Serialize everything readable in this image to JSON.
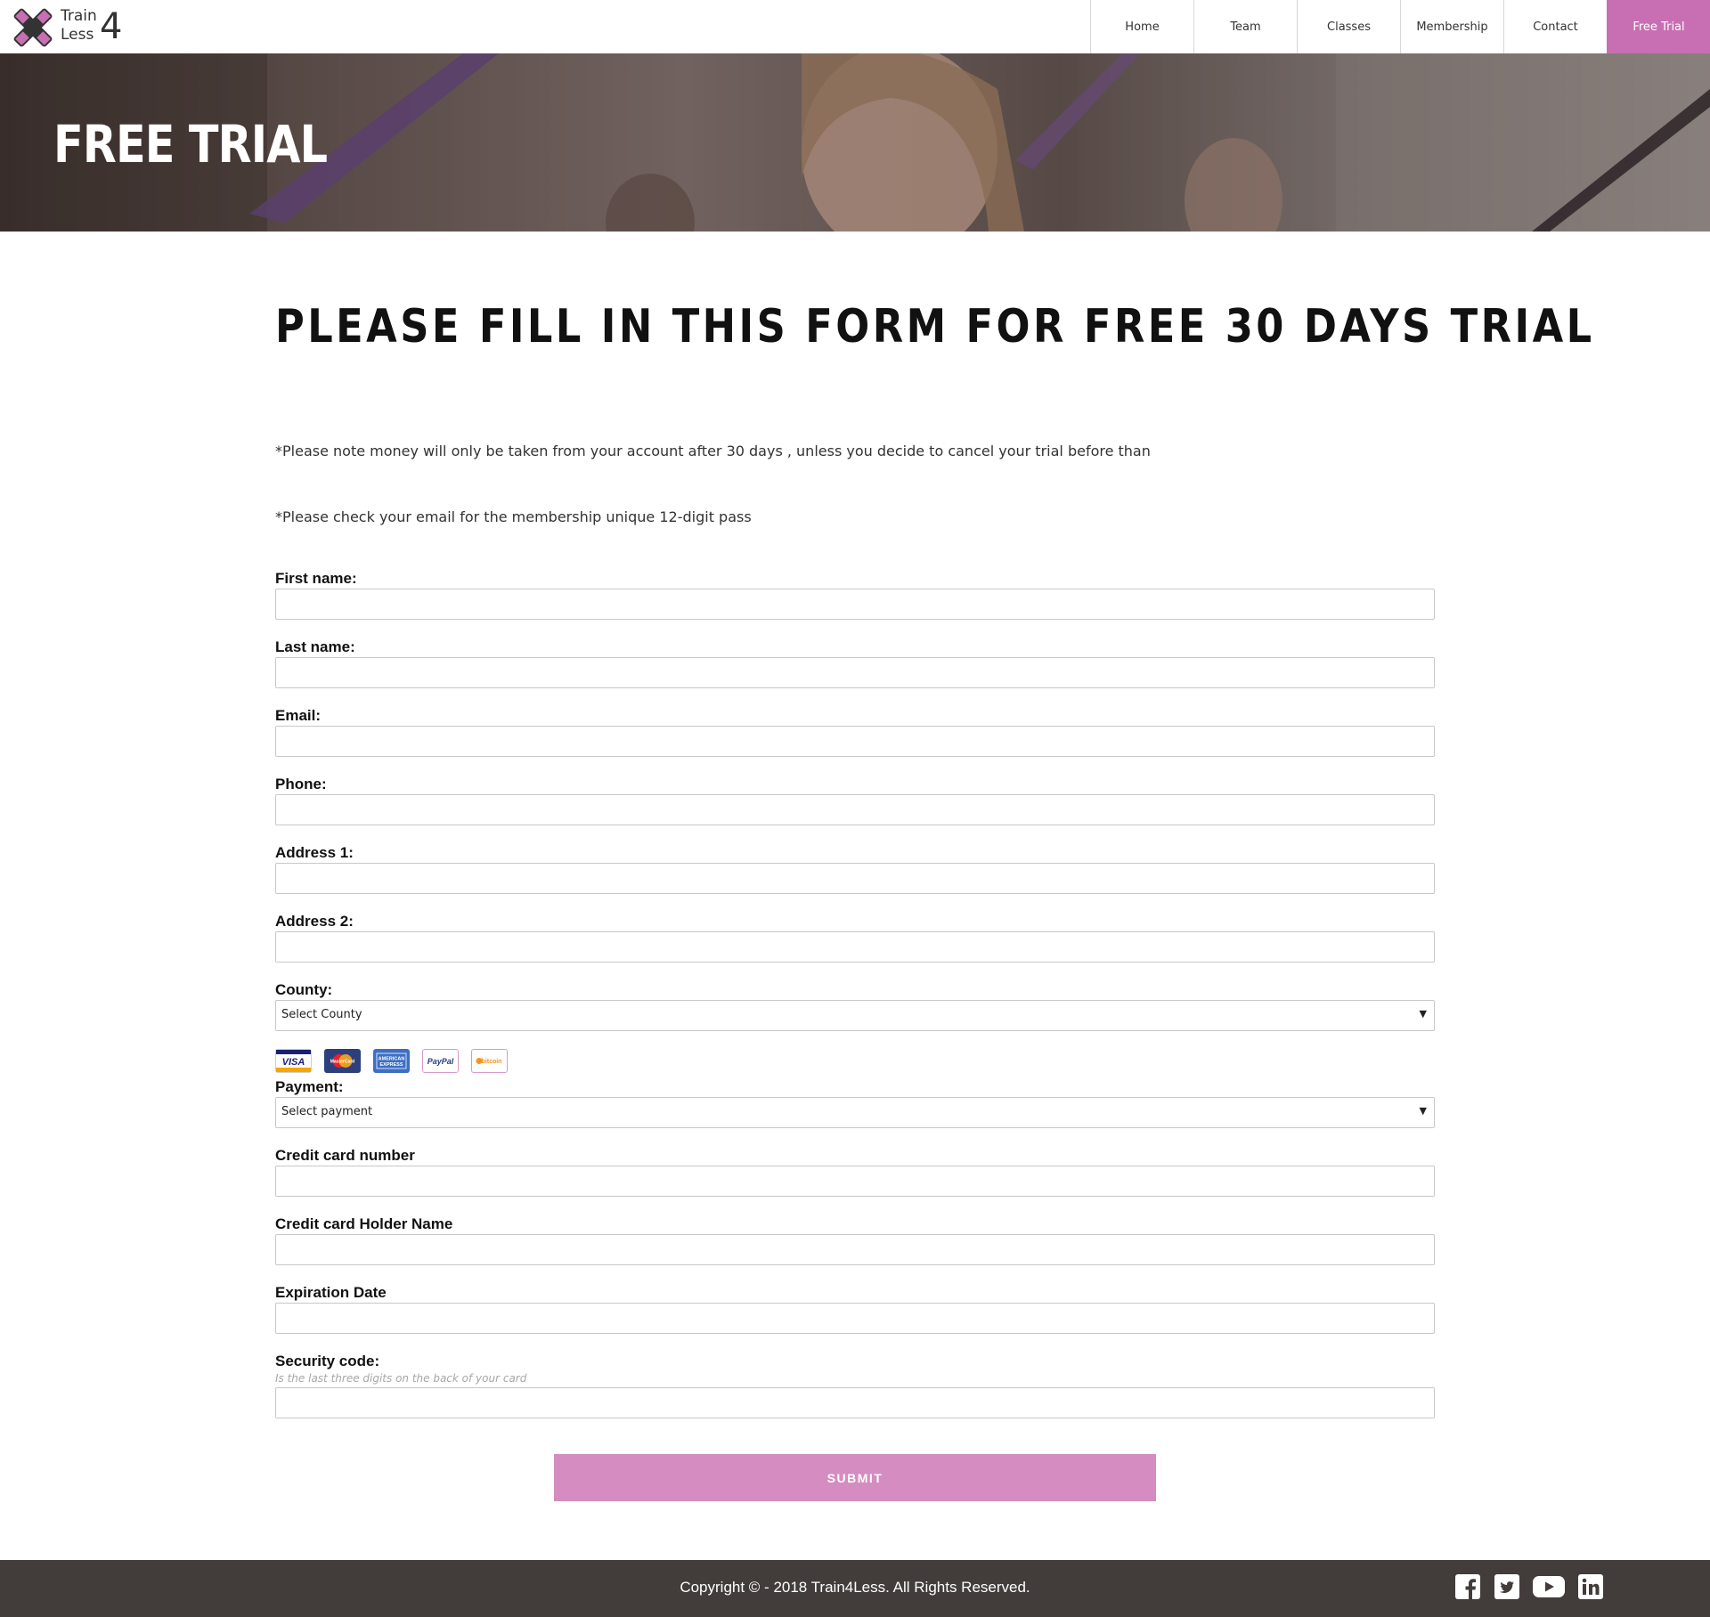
{
  "header": {
    "logo": {
      "word1": "Train",
      "word2": "Less",
      "number": "4"
    },
    "nav": [
      {
        "label": "Home",
        "active": false
      },
      {
        "label": "Team",
        "active": false
      },
      {
        "label": "Classes",
        "active": false
      },
      {
        "label": "Membership",
        "active": false
      },
      {
        "label": "Contact",
        "active": false
      },
      {
        "label": "Free Trial",
        "active": true
      }
    ]
  },
  "hero": {
    "title": "FREE TRIAL"
  },
  "main": {
    "heading": "PLEASE FILL IN THIS FORM FOR FREE 30 DAYS TRIAL",
    "note1": "*Please note money will only be taken from your account after 30 days , unless you decide to cancel your trial before than",
    "note2": "*Please check your email for the membership unique 12-digit pass",
    "fields": {
      "first_name": {
        "label": "First name:",
        "value": ""
      },
      "last_name": {
        "label": "Last name:",
        "value": ""
      },
      "email": {
        "label": "Email:",
        "value": ""
      },
      "phone": {
        "label": "Phone:",
        "value": ""
      },
      "address1": {
        "label": "Address 1:",
        "value": ""
      },
      "address2": {
        "label": "Address 2:",
        "value": ""
      },
      "county": {
        "label": "County:",
        "selected": "Select County"
      },
      "payment": {
        "label": "Payment:",
        "selected": "Select payment"
      },
      "cc_number": {
        "label": "Credit card number",
        "value": ""
      },
      "cc_holder": {
        "label": "Credit card Holder Name",
        "value": ""
      },
      "expiration": {
        "label": "Expiration Date",
        "value": ""
      },
      "security": {
        "label": "Security code:",
        "hint": "Is the last three digits on the back of your card",
        "value": ""
      }
    },
    "payment_icons": [
      "visa-card-icon",
      "mastercard-icon",
      "american-express-icon",
      "paypal-icon",
      "bitcoin-icon"
    ],
    "submit_label": "SUBMIT"
  },
  "footer": {
    "copyright": "Copyright © - 2018 Train4Less. All Rights Reserved.",
    "socials": [
      "facebook-icon",
      "twitter-icon",
      "youtube-icon",
      "linkedin-icon"
    ]
  },
  "colors": {
    "accent": "#c86fb4",
    "submit": "#d58cc1",
    "footer": "#423d3b"
  }
}
